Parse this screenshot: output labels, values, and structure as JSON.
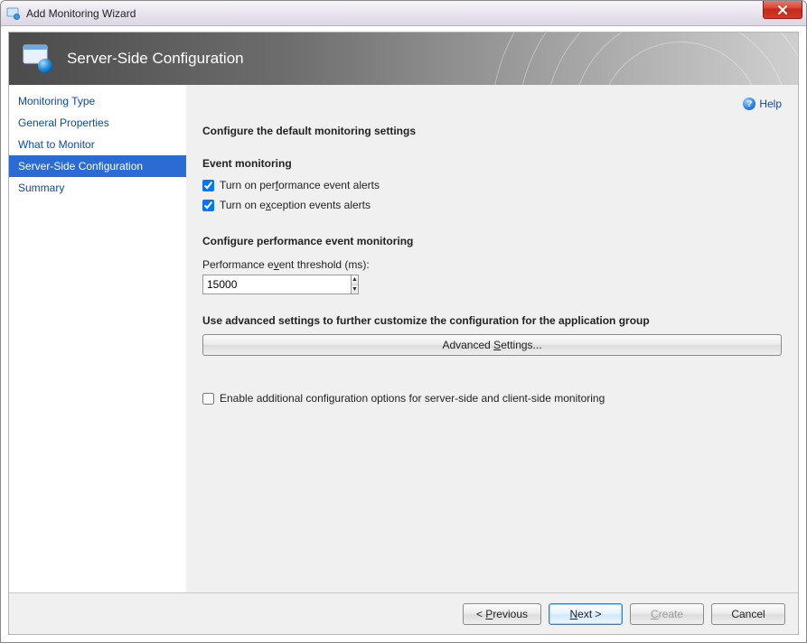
{
  "window": {
    "title": "Add Monitoring Wizard"
  },
  "banner": {
    "title": "Server-Side Configuration"
  },
  "sidebar": {
    "items": [
      {
        "label": "Monitoring Type",
        "active": false
      },
      {
        "label": "General Properties",
        "active": false
      },
      {
        "label": "What to Monitor",
        "active": false
      },
      {
        "label": "Server-Side Configuration",
        "active": true
      },
      {
        "label": "Summary",
        "active": false
      }
    ]
  },
  "help": {
    "label": "Help"
  },
  "main": {
    "heading": "Configure the default monitoring settings",
    "event_monitoring": {
      "title": "Event monitoring",
      "perf_alerts": {
        "label_pre": "Turn on per",
        "label_u": "f",
        "label_post": "ormance event alerts",
        "checked": true
      },
      "exc_alerts": {
        "label_pre": "Turn on e",
        "label_u": "x",
        "label_post": "ception events alerts",
        "checked": true
      }
    },
    "perf_config": {
      "title": "Configure performance event monitoring",
      "threshold_label_pre": "Performance e",
      "threshold_label_u": "v",
      "threshold_label_post": "ent threshold (ms):",
      "threshold_value": "15000"
    },
    "advanced": {
      "title": "Use advanced settings to further customize the configuration for the application group",
      "button_pre": "Advanced ",
      "button_u": "S",
      "button_post": "ettings..."
    },
    "enable_extra": {
      "label": "Enable additional configuration options for server-side and client-side monitoring",
      "checked": false
    }
  },
  "footer": {
    "previous_pre": "< ",
    "previous_u": "P",
    "previous_post": "revious",
    "next_u": "N",
    "next_post": "ext >",
    "create_u": "C",
    "create_post": "reate",
    "cancel": "Cancel"
  }
}
